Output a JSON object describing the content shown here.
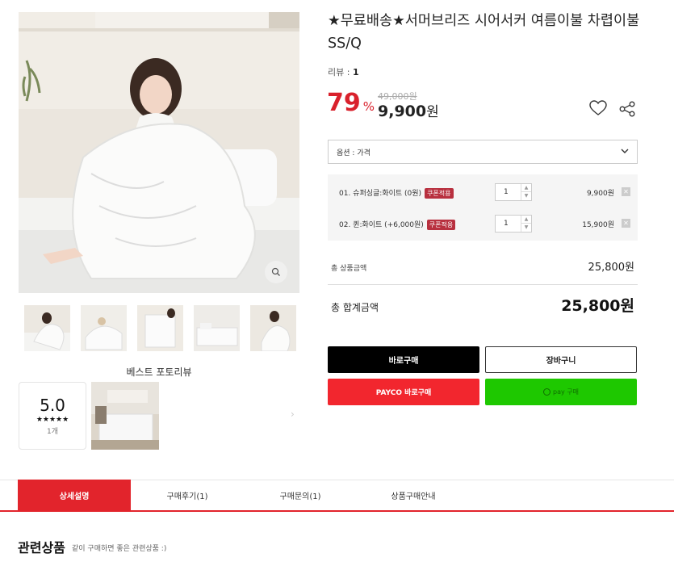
{
  "product": {
    "title": "★무료배송★서머브리즈 시어서커 여름이불 차렵이불 SS/Q",
    "review_label": "리뷰 :",
    "review_count": "1",
    "discount": "79",
    "discount_unit": "%",
    "original_price": "49,000원",
    "sale_price": "9,900",
    "sale_currency": "원"
  },
  "gallery": {
    "thumbnails": [
      "thumb-1",
      "thumb-2",
      "thumb-3",
      "thumb-4",
      "thumb-5"
    ]
  },
  "best_reviews": {
    "title": "베스트 포토리뷰",
    "score": "5.0",
    "stars": "★★★★★",
    "count": "1개"
  },
  "option_select": {
    "value": "옵션 : 가격"
  },
  "options": [
    {
      "name": "01. 슈퍼싱글:화이트 (0원)",
      "coupon": "쿠폰적용",
      "qty": "1",
      "price": "9,900원"
    },
    {
      "name": "02. 퀸:화이트 (+6,000원)",
      "coupon": "쿠폰적용",
      "qty": "1",
      "price": "15,900원"
    }
  ],
  "summary": {
    "subtotal_label": "총 상품금액",
    "subtotal_value": "25,800원",
    "total_label": "총 합계금액",
    "total_value": "25,800원"
  },
  "buttons": {
    "buy": "바로구매",
    "cart": "장바구니",
    "payco": "PAYCO 바로구매",
    "npay": "pay 구매"
  },
  "tabs": [
    "상세설명",
    "구매후기(1)",
    "구매문의(1)",
    "상품구매안내"
  ],
  "related": {
    "title": "관련상품",
    "subtitle": "같이 구매하면 좋은 관련상품 :)"
  },
  "colors": {
    "accent": "#e2242c",
    "discount": "#d9212c",
    "npay": "#1ec800",
    "payco": "#f2262e"
  }
}
